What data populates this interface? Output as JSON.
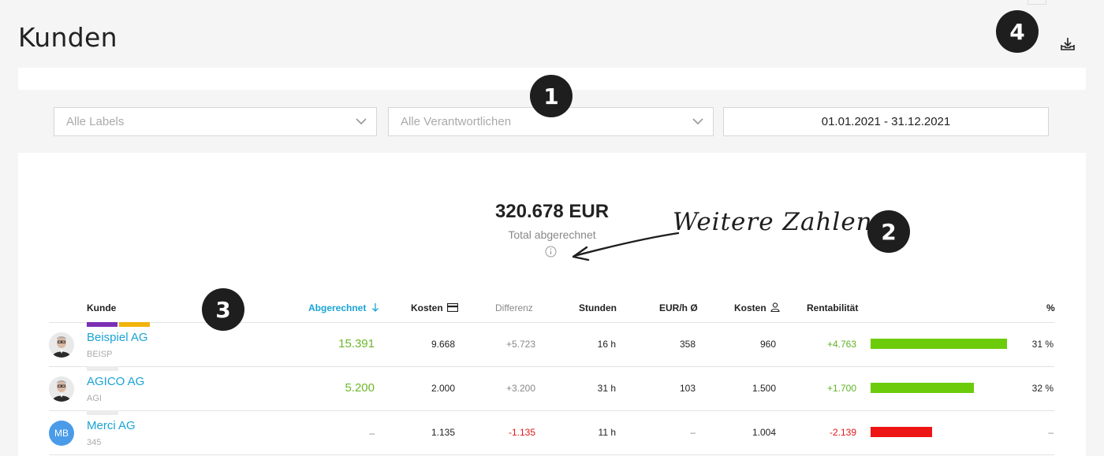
{
  "page": {
    "title": "Kunden"
  },
  "badges": [
    "1",
    "2",
    "3",
    "4"
  ],
  "icons": {
    "export": "download-tray-icon",
    "info": "info-icon",
    "chevron": "chevron-down-icon",
    "cost_card": "credit-card-icon",
    "cost_person": "person-icon",
    "sort": "arrow-down-icon"
  },
  "filters": {
    "labels": "Alle Labels",
    "responsible": "Alle Verantwortlichen",
    "date_range": "01.01.2021 - 31.12.2021"
  },
  "kpi": {
    "value": "320.678 EUR",
    "label": "Total abgerechnet"
  },
  "annotation": {
    "text": "Weitere Zahlen"
  },
  "table": {
    "headers": {
      "customer": "Kunde",
      "billed": "Abgerechnet",
      "cost": "Kosten",
      "difference": "Differenz",
      "hours": "Stunden",
      "rate": "EUR/h Ø",
      "cost_staff": "Kosten",
      "profitability": "Rentabilität",
      "percent": "%"
    },
    "rows": [
      {
        "name": "Beispiel AG",
        "code": "BEISP",
        "avatar": "photo",
        "labels": [
          "#7b2fb5",
          "#f2b40c"
        ],
        "billed": "15.391",
        "cost": "9.668",
        "difference": "+5.723",
        "hours": "16 h",
        "rate": "358",
        "cost_staff": "960",
        "profit": "+4.763",
        "profit_sign": "pos",
        "bar_fraction": 1.0,
        "bar_color": "#6ccc0c",
        "percent": "31 %"
      },
      {
        "name": "AGICO AG",
        "code": "AGI",
        "avatar": "photo",
        "labels": [],
        "billed": "5.200",
        "cost": "2.000",
        "difference": "+3.200",
        "hours": "31 h",
        "rate": "103",
        "cost_staff": "1.500",
        "profit": "+1.700",
        "profit_sign": "pos",
        "bar_fraction": 0.76,
        "bar_color": "#6ccc0c",
        "percent": "32 %"
      },
      {
        "name": "Merci AG",
        "code": "345",
        "avatar": "MB",
        "labels": [],
        "billed": "–",
        "cost": "1.135",
        "difference": "-1.135",
        "hours": "11 h",
        "rate": "–",
        "cost_staff": "1.004",
        "profit": "-2.139",
        "profit_sign": "neg",
        "bar_fraction": 0.45,
        "bar_color": "#ee1515",
        "percent": "–"
      }
    ]
  }
}
